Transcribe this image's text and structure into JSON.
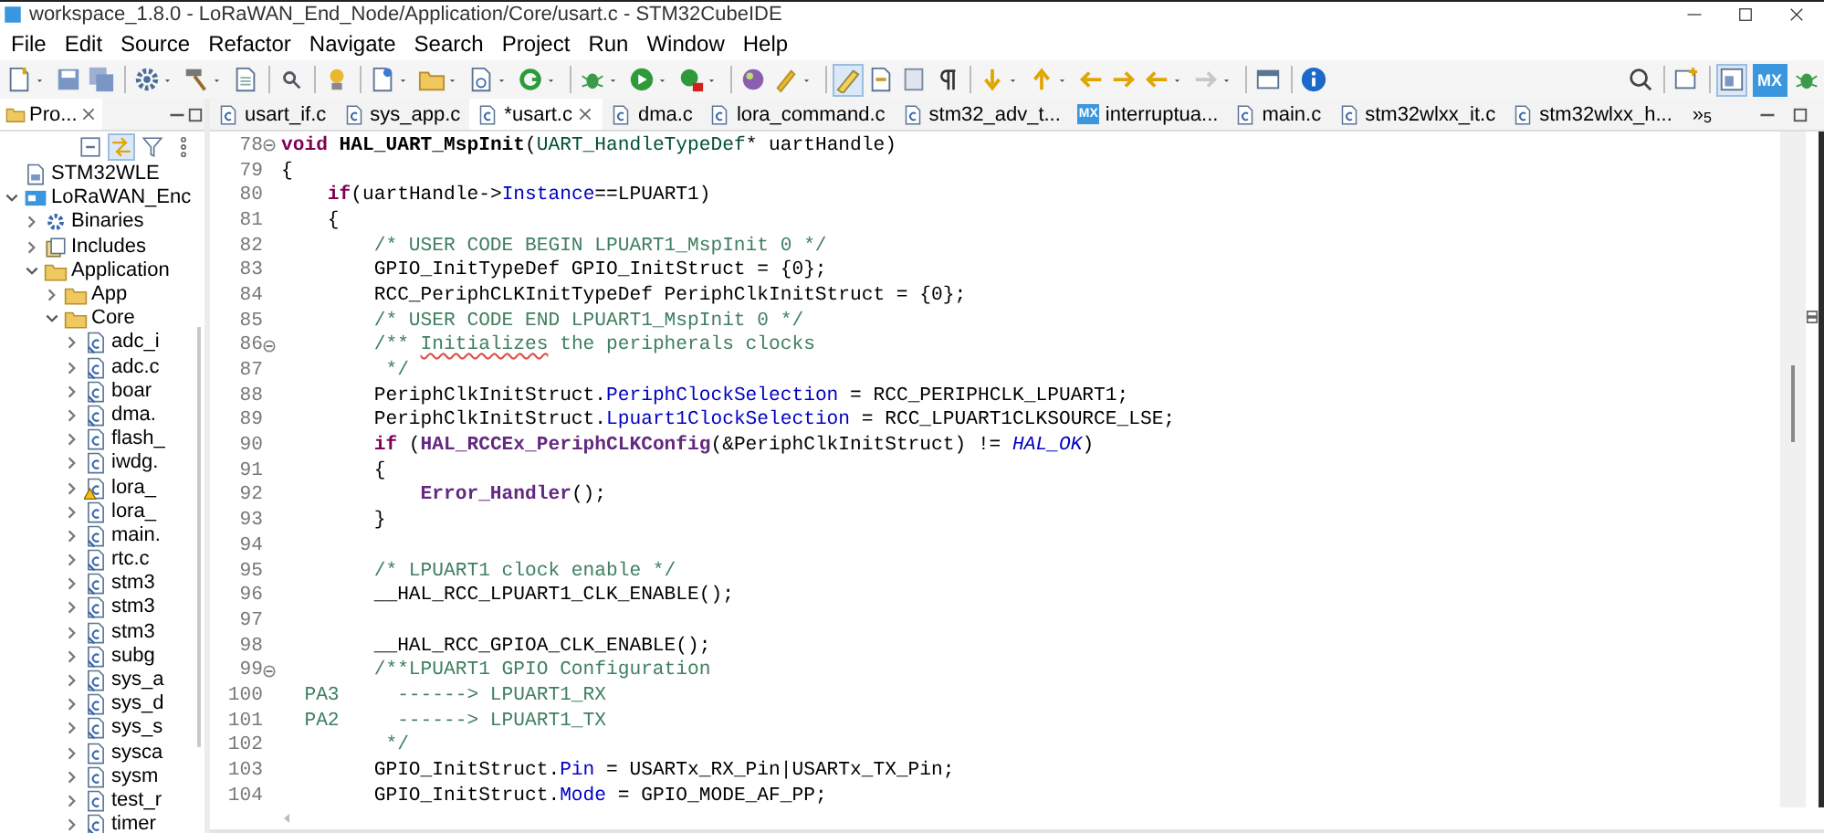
{
  "window": {
    "title": "workspace_1.8.0 - LoRaWAN_End_Node/Application/Core/usart.c - STM32CubeIDE"
  },
  "menu": [
    "File",
    "Edit",
    "Source",
    "Refactor",
    "Navigate",
    "Search",
    "Project",
    "Run",
    "Window",
    "Help"
  ],
  "toolbar": [
    {
      "kind": "button",
      "caret": true,
      "selected": false
    },
    {
      "kind": "button",
      "caret": false,
      "selected": false
    },
    {
      "kind": "button",
      "caret": false,
      "selected": false
    },
    {
      "kind": "separator"
    },
    {
      "kind": "button",
      "caret": true,
      "selected": false
    },
    {
      "kind": "button",
      "caret": true,
      "selected": false
    },
    {
      "kind": "button",
      "caret": false,
      "selected": false
    },
    {
      "kind": "separator"
    },
    {
      "kind": "button",
      "caret": false,
      "selected": false
    },
    {
      "kind": "separator"
    },
    {
      "kind": "button",
      "caret": false,
      "selected": false
    },
    {
      "kind": "separator"
    },
    {
      "kind": "button",
      "caret": true,
      "selected": false
    },
    {
      "kind": "button",
      "caret": true,
      "selected": false
    },
    {
      "kind": "button",
      "caret": true,
      "selected": false
    },
    {
      "kind": "button",
      "caret": true,
      "selected": false
    },
    {
      "kind": "separator"
    },
    {
      "kind": "button",
      "caret": true,
      "selected": false
    },
    {
      "kind": "button",
      "caret": true,
      "selected": false
    },
    {
      "kind": "button",
      "caret": true,
      "selected": false
    },
    {
      "kind": "separator"
    },
    {
      "kind": "button",
      "caret": false,
      "selected": false
    },
    {
      "kind": "button",
      "caret": true,
      "selected": false
    },
    {
      "kind": "separator"
    },
    {
      "kind": "button",
      "caret": false,
      "selected": true
    },
    {
      "kind": "button",
      "caret": false,
      "selected": false
    },
    {
      "kind": "button",
      "caret": false,
      "selected": false
    },
    {
      "kind": "button",
      "caret": false,
      "selected": false
    },
    {
      "kind": "separator"
    },
    {
      "kind": "button",
      "caret": true,
      "selected": false
    },
    {
      "kind": "button",
      "caret": true,
      "selected": false
    },
    {
      "kind": "button",
      "caret": false,
      "selected": false
    },
    {
      "kind": "button",
      "caret": false,
      "selected": false
    },
    {
      "kind": "button",
      "caret": true,
      "selected": false
    },
    {
      "kind": "button",
      "caret": true,
      "selected": false
    },
    {
      "kind": "separator"
    },
    {
      "kind": "button",
      "caret": false,
      "selected": false
    },
    {
      "kind": "separator"
    },
    {
      "kind": "button",
      "caret": false,
      "selected": false
    },
    {
      "kind": "spacer"
    },
    {
      "kind": "button",
      "caret": false,
      "selected": false
    },
    {
      "kind": "separator"
    },
    {
      "kind": "button",
      "caret": false,
      "selected": false
    },
    {
      "kind": "separator"
    },
    {
      "kind": "button",
      "caret": false,
      "selected": true
    },
    {
      "kind": "text-button",
      "label": "MX",
      "selected": false
    },
    {
      "kind": "button",
      "caret": false,
      "selected": false
    }
  ],
  "project_explorer": {
    "tab": {
      "label": "Pro...",
      "selected": true
    },
    "items": [
      {
        "label": "STM32WLE",
        "kind": "config-file"
      },
      {
        "label": "LoRaWAN_Enc",
        "kind": "project",
        "expanded": true,
        "children": [
          {
            "label": "Binaries",
            "kind": "binaries",
            "expanded": false
          },
          {
            "label": "Includes",
            "kind": "includes",
            "expanded": false
          },
          {
            "label": "Application",
            "kind": "folder",
            "expanded": true,
            "children": [
              {
                "label": "App",
                "kind": "folder",
                "expanded": false
              },
              {
                "label": "Core",
                "kind": "folder",
                "expanded": true,
                "children": [
                  {
                    "label": "adc_i",
                    "kind": "c-linked",
                    "expanded": false,
                    "warning": false
                  },
                  {
                    "label": "adc.c",
                    "kind": "c-linked",
                    "expanded": false,
                    "warning": false
                  },
                  {
                    "label": "boar",
                    "kind": "c-linked",
                    "expanded": false,
                    "warning": false
                  },
                  {
                    "label": "dma.",
                    "kind": "c-linked",
                    "expanded": false,
                    "warning": false
                  },
                  {
                    "label": "flash_",
                    "kind": "c-file",
                    "expanded": false,
                    "warning": false
                  },
                  {
                    "label": "iwdg.",
                    "kind": "c-file",
                    "expanded": false,
                    "warning": false
                  },
                  {
                    "label": "lora_",
                    "kind": "c-file",
                    "expanded": false,
                    "warning": true
                  },
                  {
                    "label": "lora_",
                    "kind": "c-file",
                    "expanded": false,
                    "warning": false
                  },
                  {
                    "label": "main.",
                    "kind": "c-linked",
                    "expanded": false,
                    "warning": false
                  },
                  {
                    "label": "rtc.c",
                    "kind": "c-linked",
                    "expanded": false,
                    "warning": false
                  },
                  {
                    "label": "stm3",
                    "kind": "c-linked",
                    "expanded": false,
                    "warning": false
                  },
                  {
                    "label": "stm3",
                    "kind": "c-linked",
                    "expanded": false,
                    "warning": false
                  },
                  {
                    "label": "stm3",
                    "kind": "c-linked",
                    "expanded": false,
                    "warning": false
                  },
                  {
                    "label": "subg",
                    "kind": "c-linked",
                    "expanded": false,
                    "warning": false
                  },
                  {
                    "label": "sys_a",
                    "kind": "c-linked",
                    "expanded": false,
                    "warning": false
                  },
                  {
                    "label": "sys_d",
                    "kind": "c-linked",
                    "expanded": false,
                    "warning": false
                  },
                  {
                    "label": "sys_s",
                    "kind": "c-linked",
                    "expanded": false,
                    "warning": false
                  },
                  {
                    "label": "sysca",
                    "kind": "c-file",
                    "expanded": false,
                    "warning": false
                  },
                  {
                    "label": "sysm",
                    "kind": "c-file",
                    "expanded": false,
                    "warning": false
                  },
                  {
                    "label": "test_r",
                    "kind": "c-file",
                    "expanded": false,
                    "warning": false
                  },
                  {
                    "label": "timer",
                    "kind": "c-linked",
                    "expanded": false,
                    "warning": false
                  }
                ]
              }
            ]
          }
        ]
      }
    ]
  },
  "editor_tabs": [
    {
      "label": "usart_if.c",
      "kind": "c-file",
      "selected": false
    },
    {
      "label": "sys_app.c",
      "kind": "c-file",
      "selected": false
    },
    {
      "label": "*usart.c",
      "kind": "c-file",
      "selected": true
    },
    {
      "label": "dma.c",
      "kind": "c-file",
      "selected": false
    },
    {
      "label": "lora_command.c",
      "kind": "c-file",
      "selected": false
    },
    {
      "label": "stm32_adv_t...",
      "kind": "c-file",
      "selected": false
    },
    {
      "label": "interruptua...",
      "kind": "mx-file",
      "icon_text": "MX",
      "selected": false
    },
    {
      "label": "main.c",
      "kind": "c-file",
      "selected": false
    },
    {
      "label": "stm32wlxx_it.c",
      "kind": "c-file",
      "selected": false
    },
    {
      "label": "stm32wlxx_h...",
      "kind": "c-file",
      "selected": false
    }
  ],
  "tab_overflow": {
    "symbol": "»",
    "count": "5"
  },
  "code": [
    {
      "number": "78",
      "fold": true,
      "tokens": [
        {
          "kind": "keyword",
          "text": "void "
        },
        {
          "kind": "declaration",
          "text": "HAL_UART_MspInit"
        },
        {
          "kind": "plain",
          "text": "("
        },
        {
          "kind": "type",
          "text": "UART_HandleTypeDef"
        },
        {
          "kind": "plain",
          "text": "* uartHandle)"
        }
      ]
    },
    {
      "number": "79",
      "fold": false,
      "tokens": [
        {
          "kind": "plain",
          "text": "{"
        }
      ]
    },
    {
      "number": "80",
      "fold": false,
      "tokens": [
        {
          "kind": "keyword",
          "text": "    if"
        },
        {
          "kind": "plain",
          "text": "(uartHandle->"
        },
        {
          "kind": "field",
          "text": "Instance"
        },
        {
          "kind": "plain",
          "text": "==LPUART1)"
        }
      ]
    },
    {
      "number": "81",
      "fold": false,
      "tokens": [
        {
          "kind": "plain",
          "text": "    {"
        }
      ]
    },
    {
      "number": "82",
      "fold": false,
      "tokens": [
        {
          "kind": "comment",
          "text": "        /* USER CODE BEGIN LPUART1_MspInit 0 */"
        }
      ]
    },
    {
      "number": "83",
      "fold": false,
      "tokens": [
        {
          "kind": "plain",
          "text": "        GPIO_InitTypeDef GPIO_InitStruct = {0};"
        }
      ]
    },
    {
      "number": "84",
      "fold": false,
      "tokens": [
        {
          "kind": "plain",
          "text": "        RCC_PeriphCLKInitTypeDef PeriphClkInitStruct = {0};"
        }
      ]
    },
    {
      "number": "85",
      "fold": false,
      "tokens": [
        {
          "kind": "comment",
          "text": "        /* USER CODE END LPUART1_MspInit 0 */"
        }
      ]
    },
    {
      "number": "86",
      "fold": true,
      "tokens": [
        {
          "kind": "comment",
          "text": "        /** "
        },
        {
          "kind": "misspelled",
          "text": "Initializes"
        },
        {
          "kind": "comment",
          "text": " the peripherals clocks"
        }
      ]
    },
    {
      "number": "87",
      "fold": false,
      "tokens": [
        {
          "kind": "comment",
          "text": "         */"
        }
      ]
    },
    {
      "number": "88",
      "fold": false,
      "tokens": [
        {
          "kind": "plain",
          "text": "        PeriphClkInitStruct."
        },
        {
          "kind": "field",
          "text": "PeriphClockSelection"
        },
        {
          "kind": "plain",
          "text": " = RCC_PERIPHCLK_LPUART1;"
        }
      ]
    },
    {
      "number": "89",
      "fold": false,
      "tokens": [
        {
          "kind": "plain",
          "text": "        PeriphClkInitStruct."
        },
        {
          "kind": "field",
          "text": "Lpuart1ClockSelection"
        },
        {
          "kind": "plain",
          "text": " = RCC_LPUART1CLKSOURCE_LSE;"
        }
      ]
    },
    {
      "number": "90",
      "fold": false,
      "tokens": [
        {
          "kind": "keyword",
          "text": "        if"
        },
        {
          "kind": "plain",
          "text": " ("
        },
        {
          "kind": "call",
          "text": "HAL_RCCEx_PeriphCLKConfig"
        },
        {
          "kind": "plain",
          "text": "(&PeriphClkInitStruct) != "
        },
        {
          "kind": "constant",
          "text": "HAL_OK"
        },
        {
          "kind": "plain",
          "text": ")"
        }
      ]
    },
    {
      "number": "91",
      "fold": false,
      "tokens": [
        {
          "kind": "plain",
          "text": "        {"
        }
      ]
    },
    {
      "number": "92",
      "fold": false,
      "tokens": [
        {
          "kind": "call",
          "text": "            Error_Handler"
        },
        {
          "kind": "plain",
          "text": "();"
        }
      ]
    },
    {
      "number": "93",
      "fold": false,
      "tokens": [
        {
          "kind": "plain",
          "text": "        }"
        }
      ]
    },
    {
      "number": "94",
      "fold": false
    },
    {
      "number": "95",
      "fold": false,
      "tokens": [
        {
          "kind": "comment",
          "text": "        /* LPUART1 clock enable */"
        }
      ]
    },
    {
      "number": "96",
      "fold": false,
      "tokens": [
        {
          "kind": "plain",
          "text": "        __HAL_RCC_LPUART1_CLK_ENABLE();"
        }
      ]
    },
    {
      "number": "97",
      "fold": false
    },
    {
      "number": "98",
      "fold": false,
      "tokens": [
        {
          "kind": "plain",
          "text": "        __HAL_RCC_GPIOA_CLK_ENABLE();"
        }
      ]
    },
    {
      "number": "99",
      "fold": true,
      "tokens": [
        {
          "kind": "comment",
          "text": "        /**LPUART1 GPIO Configuration"
        }
      ]
    },
    {
      "number": "100",
      "fold": false,
      "tokens": [
        {
          "kind": "comment",
          "text": "  PA3     ------> LPUART1_RX"
        }
      ]
    },
    {
      "number": "101",
      "fold": false,
      "tokens": [
        {
          "kind": "comment",
          "text": "  PA2     ------> LPUART1_TX"
        }
      ]
    },
    {
      "number": "102",
      "fold": false,
      "tokens": [
        {
          "kind": "comment",
          "text": "         */"
        }
      ]
    },
    {
      "number": "103",
      "fold": false,
      "tokens": [
        {
          "kind": "plain",
          "text": "        GPIO_InitStruct."
        },
        {
          "kind": "field",
          "text": "Pin"
        },
        {
          "kind": "plain",
          "text": " = USARTx_RX_Pin|USARTx_TX_Pin;"
        }
      ]
    },
    {
      "number": "104",
      "fold": false,
      "tokens": [
        {
          "kind": "plain",
          "text": "        GPIO_InitStruct."
        },
        {
          "kind": "field",
          "text": "Mode"
        },
        {
          "kind": "plain",
          "text": " = GPIO_MODE_AF_PP;"
        }
      ]
    }
  ]
}
